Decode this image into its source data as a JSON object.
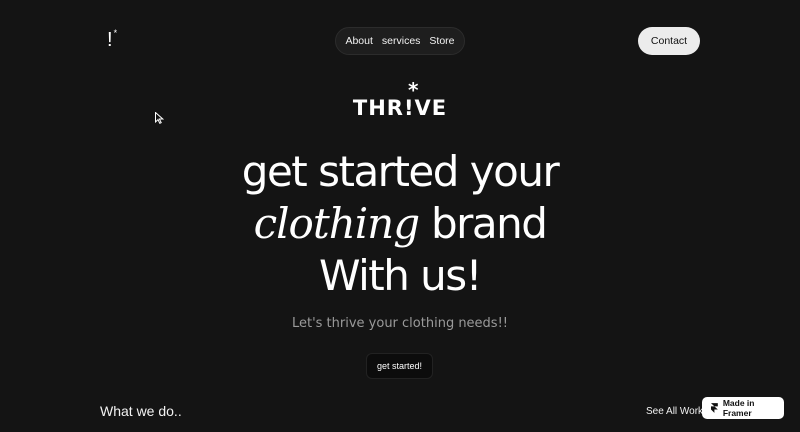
{
  "header": {
    "logo_text": "!",
    "logo_sup": "*",
    "nav": [
      "About",
      "services",
      "Store"
    ],
    "contact_label": "Contact"
  },
  "brand": {
    "name": "THR!VE",
    "star": "*"
  },
  "hero": {
    "line1": "get started your",
    "italic_word": "clothing",
    "line2_rest": " brand",
    "line3": "With us!"
  },
  "subtitle": "Let's thrive your clothing needs!!",
  "cta_label": "get started!",
  "section": {
    "title": "What we do..",
    "see_all": "See All Work"
  },
  "badge": {
    "label": "Made in Framer",
    "icon": "framer-icon"
  },
  "colors": {
    "background": "#141414",
    "text": "#ffffff",
    "muted": "#9a9a9a",
    "button_light": "#ececec"
  }
}
